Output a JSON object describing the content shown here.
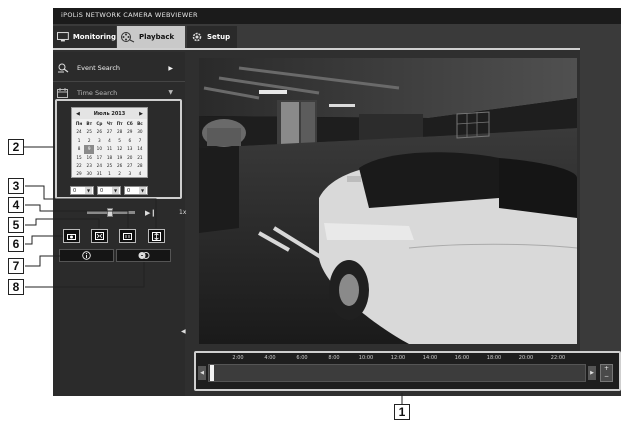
{
  "window": {
    "title": "iPOLiS NETWORK CAMERA WEBVIEWER"
  },
  "tabs": [
    {
      "label": "Monitoring",
      "icon": "monitor-icon"
    },
    {
      "label": "Playback",
      "icon": "film-reel-icon",
      "active": true
    },
    {
      "label": "Setup",
      "icon": "gear-icon"
    }
  ],
  "sidebar": {
    "items": [
      {
        "label": "Event Search",
        "icon": "event-search-icon",
        "arrow": "▶"
      },
      {
        "label": "Time Search",
        "icon": "calendar-icon",
        "arrow": "▼"
      }
    ]
  },
  "calendar": {
    "month_label": "Июль 2013",
    "prev": "◀",
    "next": "▶",
    "weekdays": [
      "Пн",
      "Вт",
      "Ср",
      "Чт",
      "Пт",
      "Сб",
      "Вс"
    ],
    "weeks": [
      [
        "24",
        "25",
        "26",
        "27",
        "28",
        "29",
        "30"
      ],
      [
        "1",
        "2",
        "3",
        "4",
        "5",
        "6",
        "7"
      ],
      [
        "8",
        "9",
        "10",
        "11",
        "12",
        "13",
        "14"
      ],
      [
        "15",
        "16",
        "17",
        "18",
        "19",
        "20",
        "21"
      ],
      [
        "22",
        "23",
        "24",
        "25",
        "26",
        "27",
        "28"
      ],
      [
        "29",
        "30",
        "31",
        "1",
        "2",
        "3",
        "4"
      ]
    ],
    "selected": "9"
  },
  "time_select": {
    "hour": "0",
    "minute": "0",
    "second": "0"
  },
  "playback": {
    "play_icon": "▶❙",
    "speed": "1x"
  },
  "timeline": {
    "labels": [
      "2:00",
      "4:00",
      "6:00",
      "8:00",
      "10:00",
      "12:00",
      "14:00",
      "16:00",
      "18:00",
      "20:00",
      "22:00"
    ],
    "left_arrow": "◀",
    "right_arrow": "▶",
    "zoom_in": "+",
    "zoom_out": "−"
  },
  "collapse_handle": "◀",
  "callouts": [
    "1",
    "2",
    "3",
    "4",
    "5",
    "6",
    "7",
    "8"
  ],
  "colors": {
    "app_background": "#2f2f2f",
    "active_tab": "#c9c9c9"
  }
}
